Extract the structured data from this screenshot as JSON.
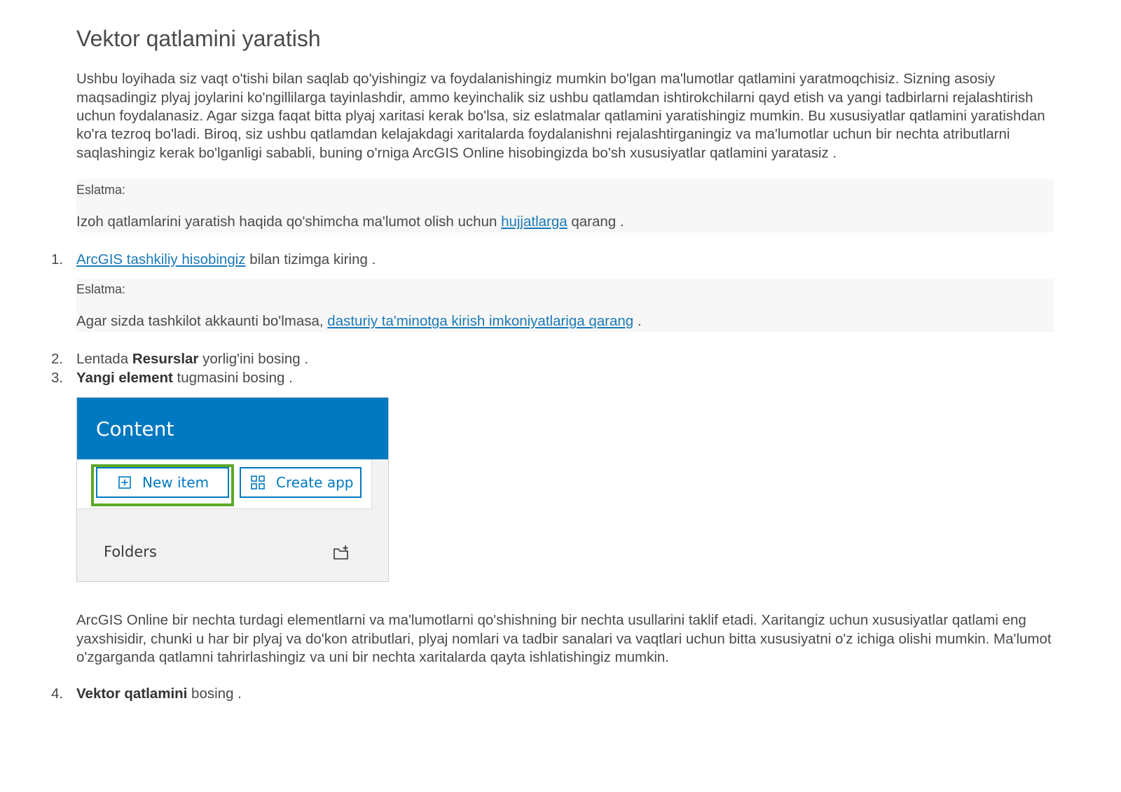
{
  "title": "Vektor qatlamini yaratish",
  "intro": "Ushbu loyihada siz vaqt o'tishi bilan saqlab qo'yishingiz va foydalanishingiz mumkin bo'lgan ma'lumotlar qatlamini yaratmoqchisiz. Sizning asosiy maqsadingiz plyaj joylarini ko'ngillilarga tayinlashdir, ammo keyinchalik siz ushbu qatlamdan ishtirokchilarni qayd etish va yangi tadbirlarni rejalashtirish uchun foydalanasiz. Agar sizga faqat bitta plyaj xaritasi kerak bo'lsa, siz eslatmalar qatlamini yaratishingiz mumkin. Bu xususiyatlar qatlamini yaratishdan ko'ra tezroq bo'ladi. Biroq, siz ushbu qatlamdan kelajakdagi xaritalarda foydalanishni rejalashtirganingiz va ma'lumotlar uchun bir nechta atributlarni saqlashingiz kerak bo'lganligi sababli, buning o'rniga ArcGIS Online hisobingizda bo'sh xususiyatlar qatlamini yaratasiz .",
  "note1": {
    "label": "Eslatma:",
    "before": "Izoh qatlamlarini yaratish haqida qo'shimcha ma'lumot olish uchun ",
    "link": "hujjatlarga",
    "after": " qarang ."
  },
  "steps": {
    "s1": {
      "num": "1.",
      "link": "ArcGIS tashkiliy hisobingiz",
      "after": " bilan tizimga kiring ."
    },
    "note2": {
      "label": "Eslatma:",
      "before": "Agar sizda tashkilot akkaunti bo'lmasa, ",
      "link": "dasturiy ta'minotga kirish imkoniyatlariga qarang",
      "after": " ."
    },
    "s2": {
      "num": "2.",
      "before": "Lentada ",
      "bold": "Resurslar",
      "after": " yorlig'ini bosing ."
    },
    "s3": {
      "num": "3.",
      "bold": "Yangi element",
      "after": " tugmasini bosing ."
    },
    "s4": {
      "num": "4.",
      "bold": "Vektor qatlamini",
      "after": " bosing ."
    }
  },
  "screenshot": {
    "header": "Content",
    "new_item": "New item",
    "create_app": "Create app",
    "folders": "Folders",
    "colors": {
      "header": "#0079c1",
      "highlight": "#5ba829"
    }
  },
  "after_shot": "ArcGIS Online bir nechta turdagi elementlarni va ma'lumotlarni qo'shishning bir nechta usullarini taklif etadi. Xaritangiz uchun xususiyatlar qatlami eng yaxshisidir, chunki u har bir plyaj va do'kon atributlari, plyaj nomlari va tadbir sanalari va vaqtlari uchun bitta xususiyatni o'z ichiga olishi mumkin. Ma'lumot o'zgarganda qatlamni tahrirlashingiz va uni bir nechta xaritalarda qayta ishlatishingiz mumkin."
}
